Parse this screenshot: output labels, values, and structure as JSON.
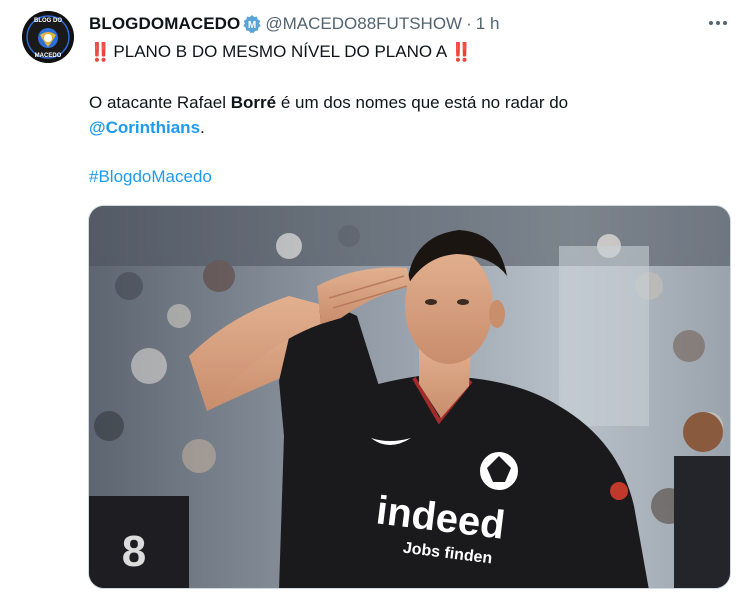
{
  "tweet": {
    "author": {
      "display_name": "BLOGDOMACEDO",
      "handle": "@MACEDO88FUTSHOW",
      "avatar_text_top": "BLOG DO",
      "avatar_text_bottom": "MACEDO",
      "verified_badge": "M"
    },
    "separator": "·",
    "timestamp": "1 h",
    "more_icon": "more-horizontal-icon",
    "headline": {
      "prefix_emoji": "‼️",
      "text": "PLANO B DO MESMO NÍVEL DO PLANO A",
      "suffix_emoji": "‼️"
    },
    "body": {
      "part1": "O atacante Rafael ",
      "bold_name": "Borré",
      "part2": " é um dos nomes que está no radar do",
      "mention": "@Corinthians",
      "after_mention": "."
    },
    "hashtag": "#BlogdoMacedo",
    "media": {
      "jersey_brand": "indeed",
      "jersey_tagline": "Jobs finden",
      "back_number": "8"
    }
  },
  "colors": {
    "link": "#1d9bf0",
    "secondary_text": "#536471",
    "emoji_red": "#d91f26"
  }
}
